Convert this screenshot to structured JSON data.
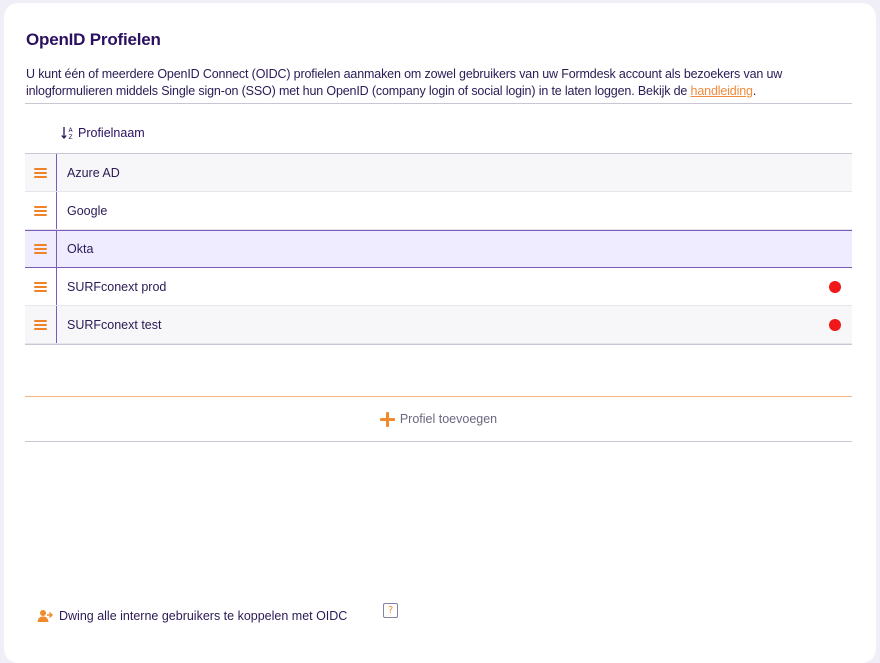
{
  "page": {
    "title": "OpenID Profielen",
    "intro_text": "U kunt één of meerdere OpenID Connect (OIDC) profielen aanmaken om zowel gebruikers van uw Formdesk account als bezoekers van uw inlogformulieren middels Single sign-on (SSO) met hun OpenID (company login of social login) in te laten loggen. Bekijk de ",
    "intro_link": "handleiding",
    "intro_end": "."
  },
  "table": {
    "column_header": "Profielnaam",
    "sort_icon": "sort-az-icon",
    "rows": [
      {
        "name": "Azure AD",
        "status_dot": false
      },
      {
        "name": "Google",
        "status_dot": false
      },
      {
        "name": "Okta",
        "status_dot": false,
        "selected": true
      },
      {
        "name": "SURFconext prod",
        "status_dot": true
      },
      {
        "name": "SURFconext test",
        "status_dot": true
      }
    ]
  },
  "add_profile": {
    "label": "Profiel toevoegen",
    "icon": "plus-icon"
  },
  "footer": {
    "label": "Dwing alle interne gebruikers te koppelen met OIDC",
    "icon": "user-link-icon",
    "help_label": "?"
  },
  "colors": {
    "accent": "#f08a2c",
    "brand": "#2b1060",
    "status_red": "#f01818",
    "selected_border": "#7b5ab8"
  }
}
